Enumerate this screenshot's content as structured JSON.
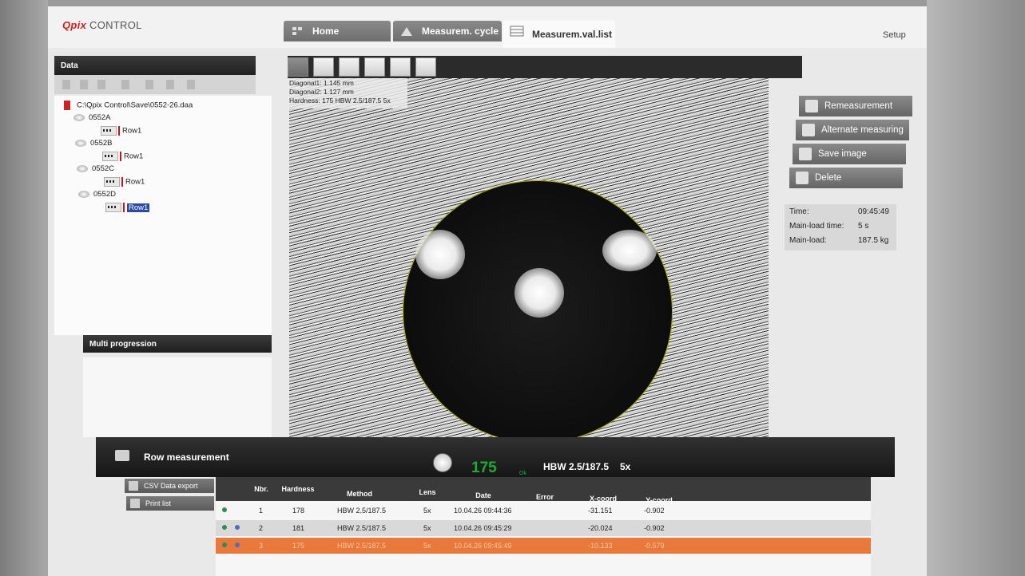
{
  "app": {
    "logo_q": "Q",
    "logo_pix": "pix",
    "logo_rest": " CONTROL",
    "setup_label": "Setup"
  },
  "tabs": [
    {
      "label": "Home"
    },
    {
      "label": "Measurem. cycle"
    },
    {
      "label": "Measurem.val.list"
    }
  ],
  "data_panel": {
    "title": "Data",
    "root_path": "C:\\Qpix Control\\Save\\0552-26.daa",
    "items": [
      {
        "name": "0552A",
        "row": "Row1"
      },
      {
        "name": "0552B",
        "row": "Row1"
      },
      {
        "name": "0552C",
        "row": "Row1"
      },
      {
        "name": "0552D",
        "row": "Row1"
      }
    ]
  },
  "multi_progression": {
    "title": "Multi progression"
  },
  "image_info": {
    "diag1": "Diagonal1: 1.145 mm",
    "diag2": "Diagonal2: 1.127 mm",
    "hardness": "Hardness: 175 HBW 2.5/187.5 5x"
  },
  "actions": {
    "remeasurement": "Remeasurement",
    "alternate": "Alternate measuring",
    "save_image": "Save image",
    "delete": "Delete"
  },
  "info": {
    "time_label": "Time:",
    "time_value": "09:45:49",
    "mlt_label": "Main-load time:",
    "mlt_value": "5 s",
    "ml_label": "Main-load:",
    "ml_value": "187.5 kg"
  },
  "row_measurement": {
    "title": "Row measurement",
    "hardness_value": "175",
    "ok": "Ok",
    "method": "HBW 2.5/187.5",
    "lens": "5x"
  },
  "left_buttons": {
    "csv": "CSV Data export",
    "print": "Print list"
  },
  "table": {
    "headers": {
      "nbr": "Nbr.",
      "hardness": "Hardness",
      "method": "Method",
      "lens": "Lens",
      "date": "Date",
      "error": "Error",
      "x": "X-coord",
      "y": "Y-coord"
    },
    "rows": [
      {
        "nbr": "1",
        "hardness": "178",
        "method": "HBW 2.5/187.5",
        "lens": "5x",
        "date": "10.04.26 09:44:36",
        "x": "-31.151",
        "y": "-0.902"
      },
      {
        "nbr": "2",
        "hardness": "181",
        "method": "HBW 2.5/187.5",
        "lens": "5x",
        "date": "10.04.26 09:45:29",
        "x": "-20.024",
        "y": "-0.902"
      },
      {
        "nbr": "3",
        "hardness": "175",
        "method": "HBW 2.5/187.5",
        "lens": "5x",
        "date": "10.04.26 09:45:49",
        "x": "-10.133",
        "y": "-0.579"
      }
    ]
  },
  "icons": [
    "tab-home-icon",
    "cycle-icon",
    "list-icon",
    "remeasure-icon",
    "alternate-icon",
    "save-icon",
    "delete-icon",
    "csv-icon",
    "print-icon"
  ]
}
